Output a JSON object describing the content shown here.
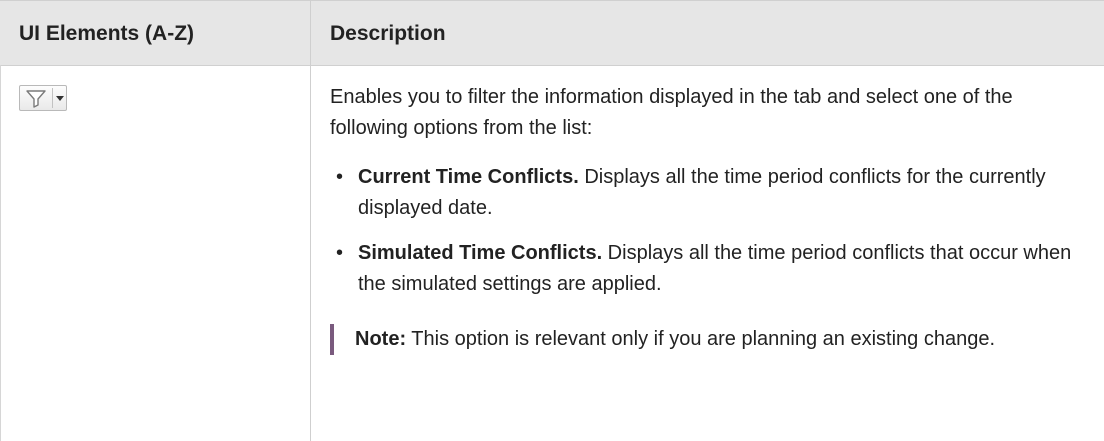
{
  "table": {
    "headers": {
      "ui_elements": "UI Elements (A-Z)",
      "description": "Description"
    },
    "row": {
      "element_icon": "filter-icon",
      "intro": "Enables you to filter the information displayed in the tab and select one of the following options from the list:",
      "options": [
        {
          "title": "Current Time Conflicts.",
          "text": " Displays all the time period conflicts for the currently displayed date."
        },
        {
          "title": "Simulated Time Conflicts.",
          "text": " Displays all the time period conflicts that occur when the simulated settings are applied."
        }
      ],
      "note": {
        "label": "Note:",
        "text": " This option is relevant only if you are planning an existing change."
      }
    }
  },
  "colors": {
    "header_bg": "#e6e6e6",
    "note_bar": "#7a5a7e",
    "text": "#222222"
  }
}
